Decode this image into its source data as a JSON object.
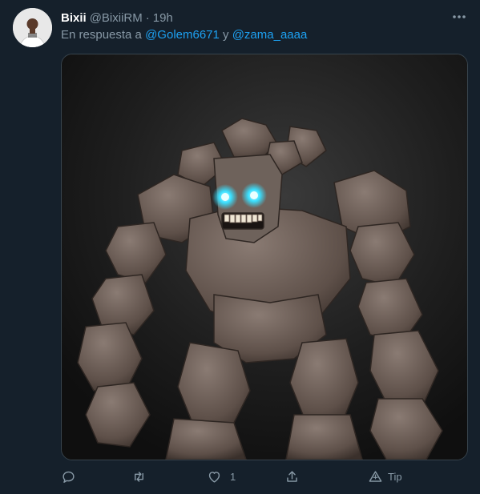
{
  "tweet": {
    "name": "Bixii",
    "handle": "@BixiiRM",
    "separator": "·",
    "time": "19h",
    "reply_prefix": "En respuesta a",
    "mention_1": "@Golem6671",
    "reply_conjunction": "y",
    "mention_2": "@zama_aaaa",
    "media_description": "golem-image"
  },
  "actions": {
    "reply_icon": "reply-icon",
    "retweet_icon": "retweet-icon",
    "like_icon": "like-icon",
    "like_count": "1",
    "share_icon": "share-icon",
    "tip_icon": "tip-icon",
    "tip_label": "Tip"
  },
  "colors": {
    "background": "#15202b",
    "secondary_text": "#8899a6",
    "link": "#1da1f2",
    "golem_eyes": "#3ae0ff"
  }
}
